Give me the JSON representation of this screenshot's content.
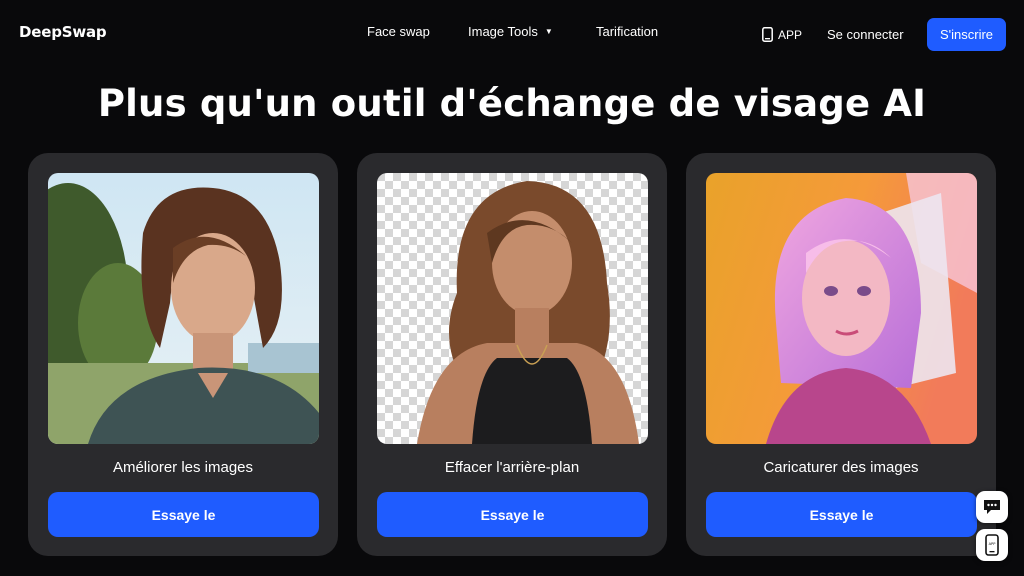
{
  "brand": {
    "logo": "DeepSwap"
  },
  "nav": {
    "face_swap": "Face swap",
    "image_tools": "Image Tools",
    "pricing": "Tarification"
  },
  "header": {
    "app_label": "APP",
    "login": "Se connecter",
    "signup": "S'inscrire"
  },
  "hero": {
    "title": "Plus qu'un outil d'échange de visage AI"
  },
  "cards": [
    {
      "label": "Améliorer les images",
      "button": "Essaye le"
    },
    {
      "label": "Effacer l'arrière-plan",
      "button": "Essaye le"
    },
    {
      "label": "Caricaturer des images",
      "button": "Essaye le"
    }
  ],
  "floating": {
    "app_small": "APP"
  },
  "colors": {
    "accent": "#1f5cff",
    "background": "#09090b",
    "card": "#2a2a2d"
  }
}
